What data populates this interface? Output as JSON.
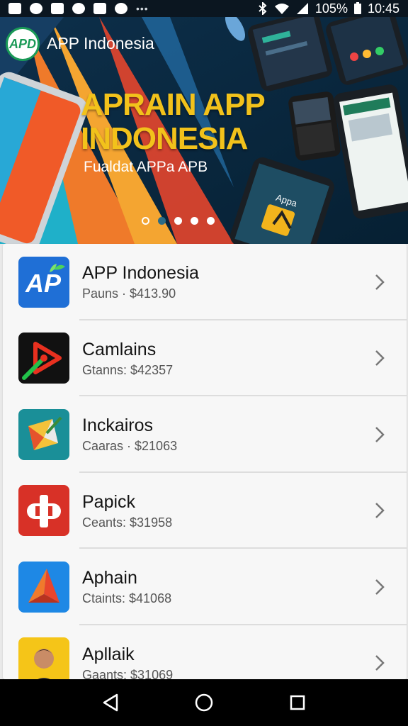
{
  "status_bar": {
    "battery_percent": "105%",
    "time": "10:45",
    "overflow": "•••"
  },
  "hero": {
    "logo_text": "APD",
    "brand": "APP Indonesia",
    "headline_line1": "APRAIN APP",
    "headline_line2": "INDONESIA",
    "subline": "Fualdat APPa APB",
    "phone_screen_text": "Appa",
    "carousel_total": 5,
    "carousel_active": 2
  },
  "apps": [
    {
      "title": "APP Indonesia",
      "subtitle": "Pauns · $413.90",
      "icon": "app-indonesia-icon"
    },
    {
      "title": "Camlains",
      "subtitle": "Gtanns: $42357",
      "icon": "camlains-icon"
    },
    {
      "title": "Inckairos",
      "subtitle": "Caaras · $21063",
      "icon": "inckairos-icon"
    },
    {
      "title": "Papick",
      "subtitle": "Ceants: $31958",
      "icon": "papick-icon"
    },
    {
      "title": "Aphain",
      "subtitle": "Ctaints: $41068",
      "icon": "aphain-icon"
    },
    {
      "title": "Apllaik",
      "subtitle": "Gaants: $31069",
      "icon": "apllaik-icon"
    }
  ],
  "colors": {
    "headline": "#f2c21b",
    "brand_green": "#1a9a57",
    "hero_bg": "#0a3350"
  }
}
